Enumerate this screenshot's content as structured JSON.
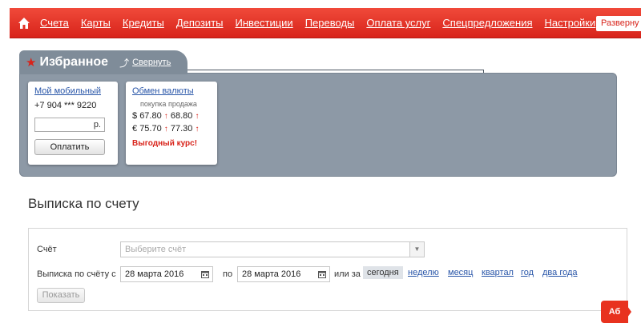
{
  "nav": {
    "items": [
      "Счета",
      "Карты",
      "Кредиты",
      "Депозиты",
      "Инвестиции",
      "Переводы",
      "Оплата услуг",
      "Спецпредложения",
      "Настройки"
    ],
    "expand_label": "Разверну"
  },
  "favorites": {
    "title": "Избранное",
    "collapse_label": "Свернуть",
    "mobile": {
      "title": "Мой мобильный",
      "phone": "+7 904 *** 9220",
      "currency_suffix": "р.",
      "pay_label": "Оплатить"
    },
    "fx": {
      "title": "Обмен валюты",
      "buy_label": "покупка",
      "sell_label": "продажа",
      "rates": [
        {
          "symbol": "$",
          "buy": "67.80",
          "sell": "68.80"
        },
        {
          "symbol": "€",
          "buy": "75.70",
          "sell": "77.30"
        }
      ],
      "promo": "Выгодный курс!"
    }
  },
  "statement": {
    "title": "Выписка по счету",
    "account_label": "Счёт",
    "account_placeholder": "Выберите счёт",
    "from_label": "Выписка по счёту с",
    "from_date": "28 марта 2016",
    "to_label": "по",
    "to_date": "28 марта 2016",
    "period_label": "или за",
    "periods": [
      "сегодня",
      "неделю",
      "месяц",
      "квартал",
      "год",
      "два года"
    ],
    "active_period": "сегодня",
    "show_label": "Показать"
  },
  "logo": {
    "text": "Аб"
  },
  "colors": {
    "brand_red": "#d8231a",
    "panel_gray": "#8d99a6",
    "link_blue": "#2855a8"
  }
}
